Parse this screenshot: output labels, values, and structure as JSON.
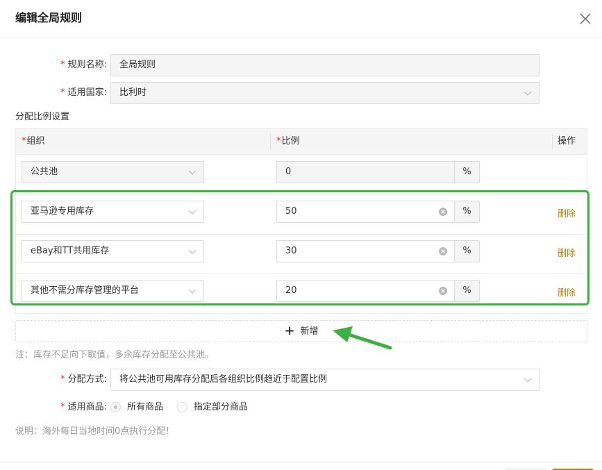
{
  "dialog": {
    "title": "编辑全局规则"
  },
  "form": {
    "rule_name": {
      "label": "规则名称:",
      "value": "全局规则"
    },
    "country": {
      "label": "适用国家:",
      "value": "比利时"
    },
    "section_label": "分配比例设置"
  },
  "table": {
    "headers": {
      "org": "组织",
      "ratio": "比例",
      "action": "操作"
    },
    "rows": [
      {
        "org": "公共池",
        "ratio": "0",
        "unit": "%",
        "action": ""
      },
      {
        "org": "亚马逊专用库存",
        "ratio": "50",
        "unit": "%",
        "action": "删除"
      },
      {
        "org": "eBay和TT共用库存",
        "ratio": "30",
        "unit": "%",
        "action": "删除"
      },
      {
        "org": "其他不需分库存管理的平台",
        "ratio": "20",
        "unit": "%",
        "action": "删除"
      }
    ],
    "add_label": "新增"
  },
  "note": "注：库存不足向下取值，多余库存分配至公共池。",
  "allocation": {
    "label": "分配方式:",
    "value": "将公共池可用库存分配后各组织比例趋近于配置比例"
  },
  "products": {
    "label": "适用商品:",
    "options": [
      "所有商品",
      "指定部分商品"
    ]
  },
  "explanation": "说明：海外每日当地时间0点执行分配！",
  "colors": {
    "required": "#d9302a",
    "delete_link": "#b8860b",
    "highlight": "#3cb043"
  }
}
